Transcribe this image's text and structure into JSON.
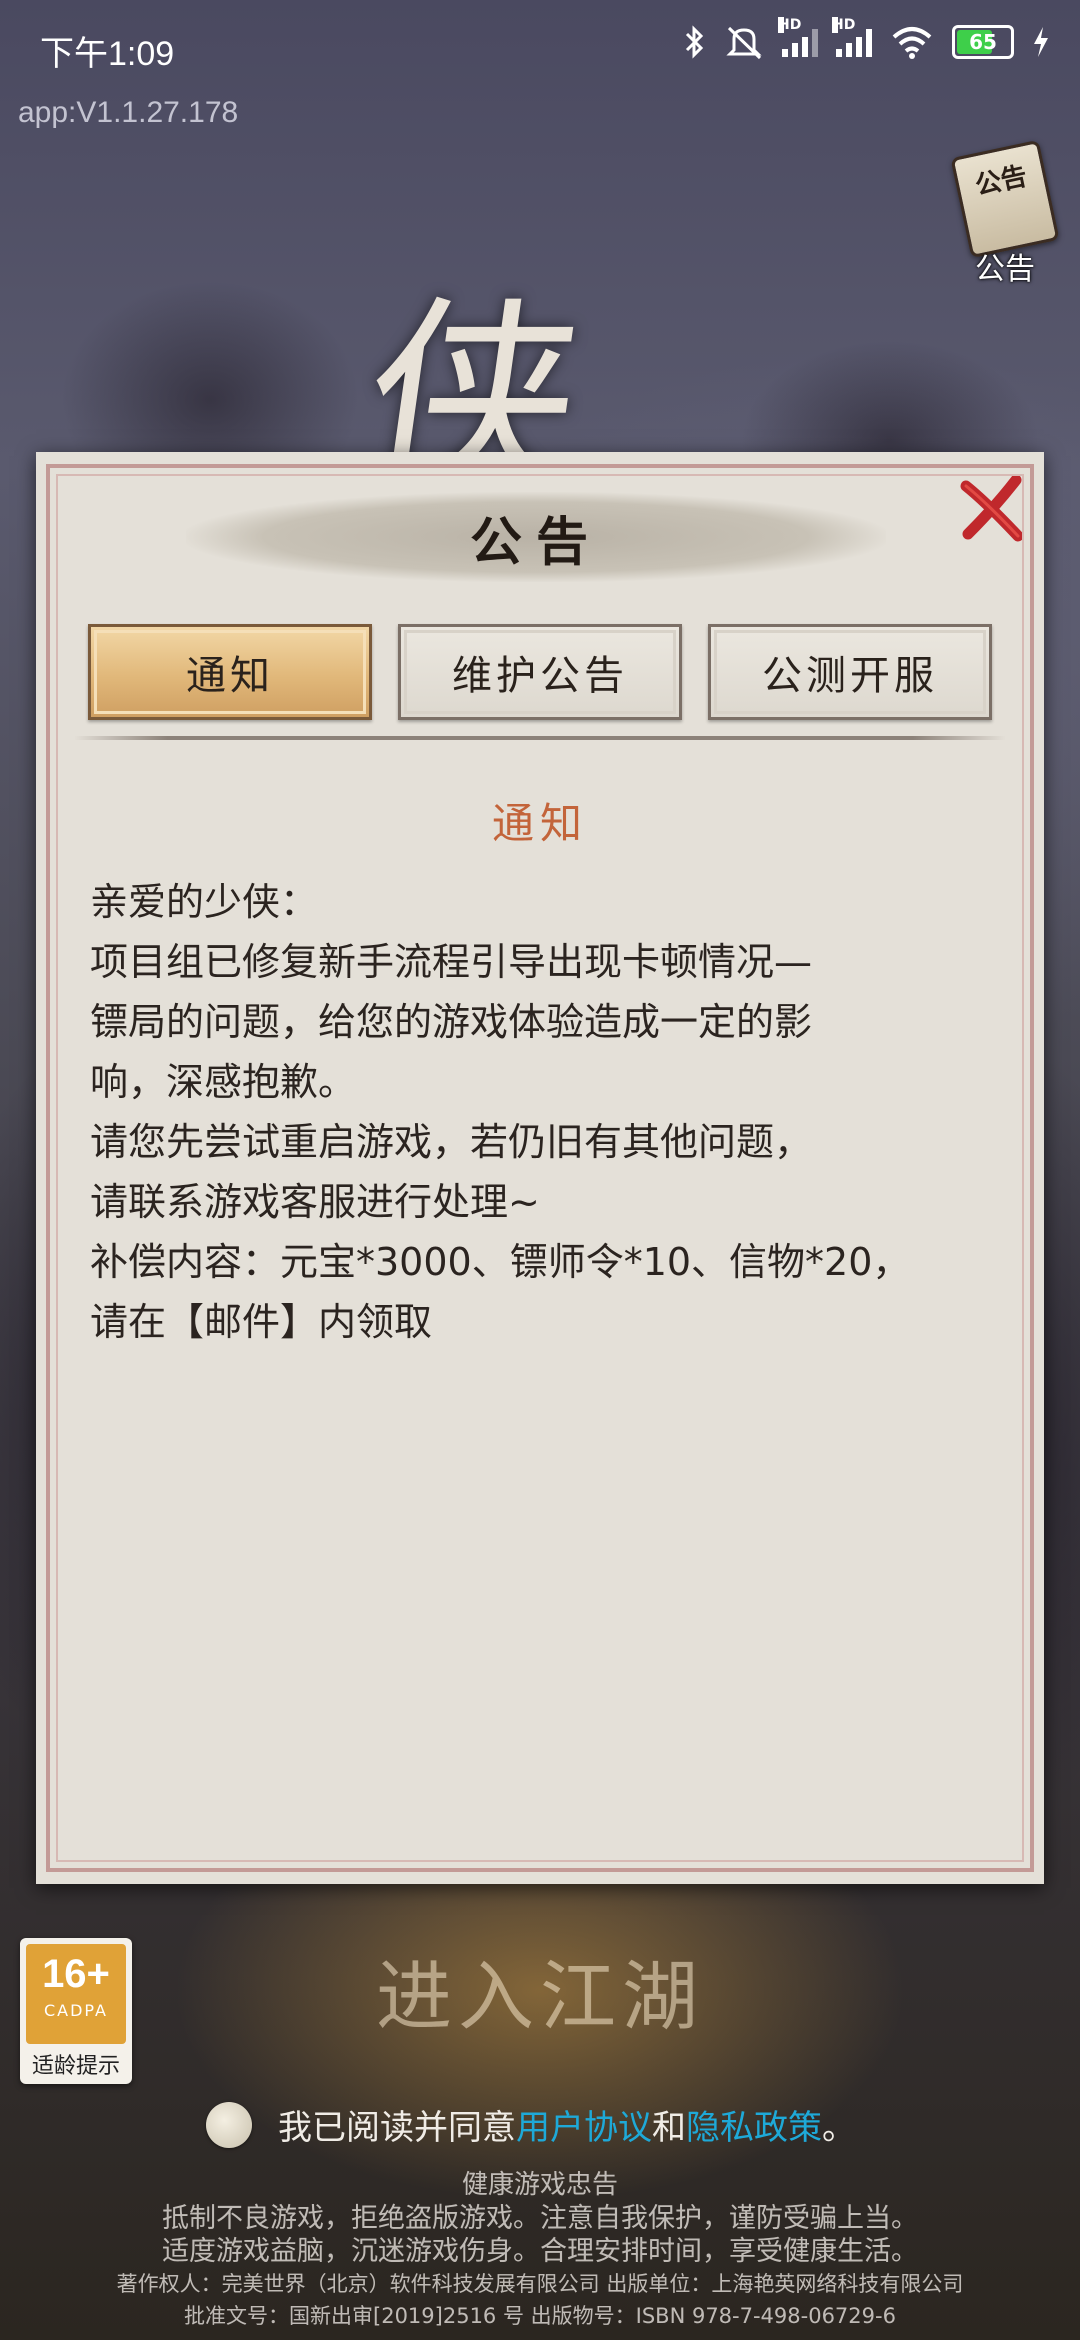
{
  "status_bar": {
    "time": "下午1:09",
    "battery": "65",
    "signal_labels": [
      "HD",
      "HD"
    ]
  },
  "app_version": "app:V1.1.27.178",
  "notice_button": {
    "icon_text": "公告",
    "label": "公告"
  },
  "game_title_char": "侠",
  "dialog": {
    "title": "公告",
    "tabs": [
      {
        "label": "通知",
        "active": true
      },
      {
        "label": "维护公告",
        "active": false
      },
      {
        "label": "公测开服",
        "active": false
      }
    ],
    "content_title": "通知",
    "content_lines": [
      "亲爱的少侠：",
      "项目组已修复新手流程引导出现卡顿情况—",
      "镖局的问题，给您的游戏体验造成一定的影",
      "响，深感抱歉。",
      "请您先尝试重启游戏，若仍旧有其他问题，",
      "请联系游戏客服进行处理~",
      "补偿内容：元宝*3000、镖师令*10、信物*20，",
      "请在【邮件】内领取"
    ]
  },
  "enter_button": "进入江湖",
  "age_rating": {
    "age": "16+",
    "org": "CADPA",
    "label": "适龄提示"
  },
  "agreement": {
    "prefix": "我已阅读并同意",
    "link1": "用户协议",
    "middle": "和",
    "link2": "隐私政策",
    "suffix": "。"
  },
  "footer": {
    "header": "健康游戏忠告",
    "line1": "抵制不良游戏，拒绝盗版游戏。注意自我保护，谨防受骗上当。",
    "line2": "适度游戏益脑，沉迷游戏伤身。合理安排时间，享受健康生活。",
    "line3": "著作权人：完美世界（北京）软件科技发展有限公司  出版单位：上海艳英网络科技有限公司",
    "line4": "批准文号：国新出审[2019]2516 号 出版物号：ISBN 978-7-498-06729-6"
  },
  "colors": {
    "accent_orange": "#c3643a",
    "link_blue": "#1ea9d8",
    "active_tab": "#e1b87a",
    "close_red": "#c0282c",
    "age_badge": "#e0a237"
  }
}
